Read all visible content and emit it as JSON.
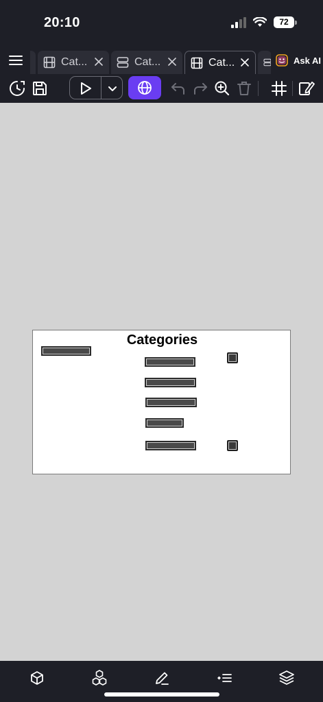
{
  "status_bar": {
    "time": "20:10",
    "battery": "72"
  },
  "tabs": [
    {
      "label": "Cat...",
      "icon": "film-icon",
      "active": false
    },
    {
      "label": "Cat...",
      "icon": "layout-rows-icon",
      "active": false
    },
    {
      "label": "Cat...",
      "icon": "film-icon",
      "active": true
    }
  ],
  "ask_ai": {
    "label": "Ask AI",
    "icon": "smiley-icon",
    "accent": "#f5a623"
  },
  "toolbar": {
    "accent": "#6a3df2",
    "icons": [
      "history-icon",
      "save-icon",
      "play-icon",
      "chevron-down-icon",
      "globe-icon",
      "undo-icon",
      "redo-icon",
      "zoom-in-icon",
      "trash-icon",
      "grid-icon",
      "edit-icon"
    ]
  },
  "canvas": {
    "background": "#d3d3d3",
    "frame_title": "Categories"
  },
  "bottom_bar": {
    "icons": [
      "cube-icon",
      "cubes-icon",
      "pencil-icon",
      "list-icon",
      "layers-icon"
    ]
  }
}
